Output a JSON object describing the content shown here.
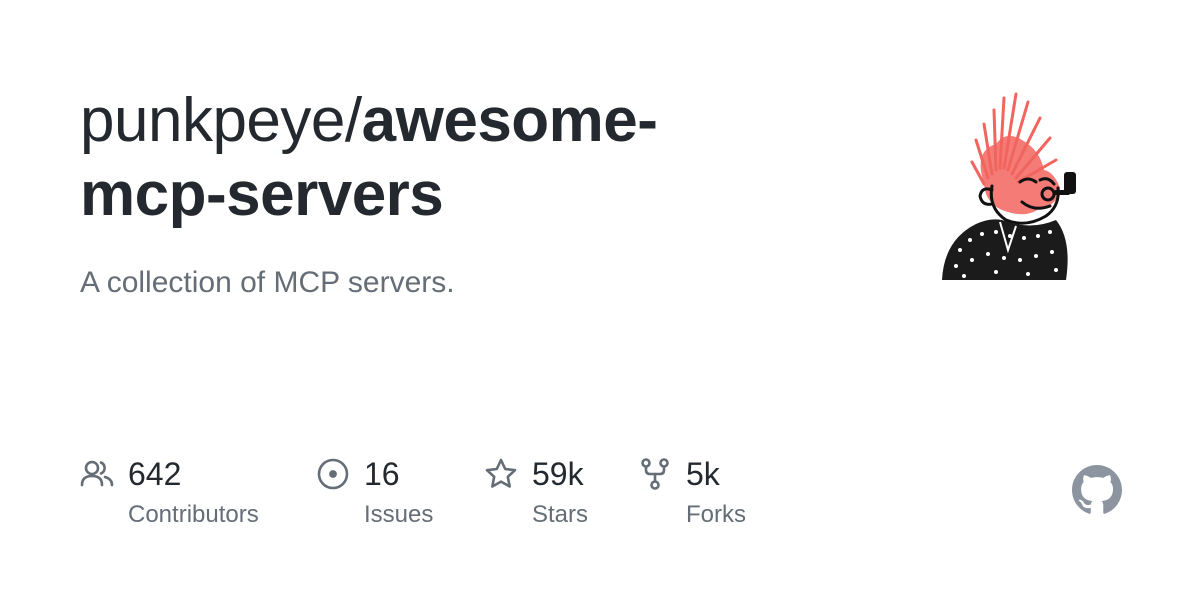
{
  "repo": {
    "owner": "punkpeye/",
    "name": "awesome-mcp-servers",
    "description": "A collection of MCP servers."
  },
  "stats": [
    {
      "icon": "people-icon",
      "value": "642",
      "label": "Contributors"
    },
    {
      "icon": "issue-icon",
      "value": "16",
      "label": "Issues"
    },
    {
      "icon": "star-icon",
      "value": "59k",
      "label": "Stars"
    },
    {
      "icon": "fork-icon",
      "value": "5k",
      "label": "Forks"
    }
  ],
  "colors": {
    "text": "#24292f",
    "muted": "#656d76",
    "mohawk": "#f2645e",
    "github_logo": "#8c959f"
  }
}
